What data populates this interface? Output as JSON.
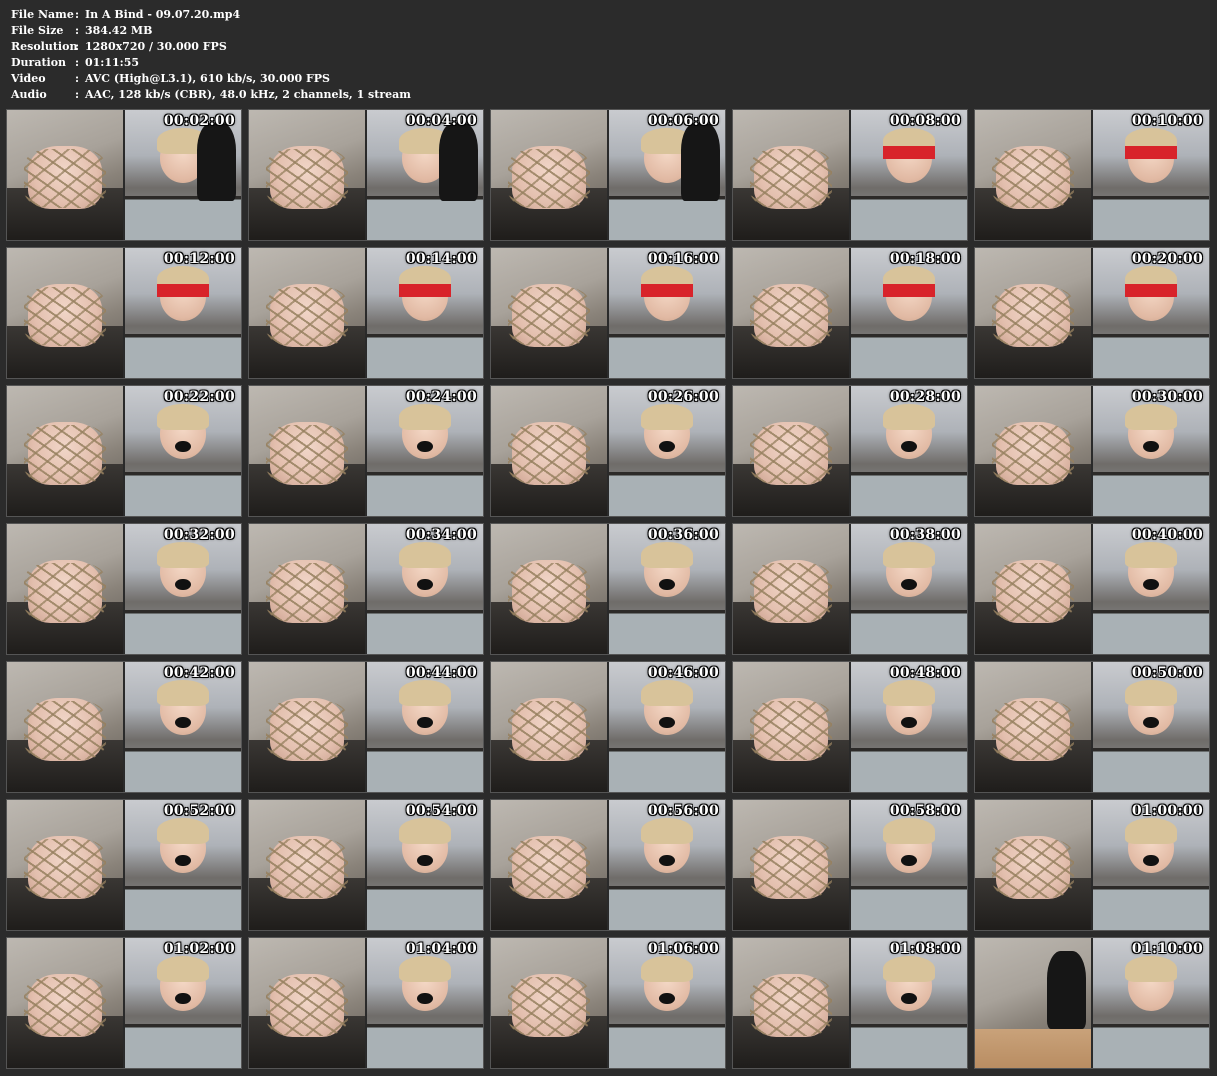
{
  "info": [
    {
      "label": "File Name",
      "sep": ":",
      "value": "In A Bind - 09.07.20.mp4"
    },
    {
      "label": "File Size",
      "sep": ":",
      "value": "384.42 MB"
    },
    {
      "label": "Resolution",
      "sep": ":",
      "value": "1280x720 / 30.000 FPS"
    },
    {
      "label": "Duration",
      "sep": ":",
      "value": "01:11:55"
    },
    {
      "label": "Video",
      "sep": ":",
      "value": "AVC (High@L3.1), 610 kb/s, 30.000 FPS"
    },
    {
      "label": "Audio",
      "sep": ":",
      "value": "AAC, 128 kb/s (CBR), 48.0 kHz, 2 channels, 1 stream"
    }
  ],
  "thumbnails": [
    {
      "time": "00:02:00",
      "variant": "man"
    },
    {
      "time": "00:04:00",
      "variant": "man"
    },
    {
      "time": "00:06:00",
      "variant": "man"
    },
    {
      "time": "00:08:00",
      "variant": "blindfold"
    },
    {
      "time": "00:10:00",
      "variant": "blindfold"
    },
    {
      "time": "00:12:00",
      "variant": "blindfold"
    },
    {
      "time": "00:14:00",
      "variant": "blindfold"
    },
    {
      "time": "00:16:00",
      "variant": "blindfold"
    },
    {
      "time": "00:18:00",
      "variant": "blindfold"
    },
    {
      "time": "00:20:00",
      "variant": "blindfold"
    },
    {
      "time": "00:22:00",
      "variant": "gag"
    },
    {
      "time": "00:24:00",
      "variant": "gag"
    },
    {
      "time": "00:26:00",
      "variant": "gag"
    },
    {
      "time": "00:28:00",
      "variant": "gag"
    },
    {
      "time": "00:30:00",
      "variant": "gag"
    },
    {
      "time": "00:32:00",
      "variant": "gag"
    },
    {
      "time": "00:34:00",
      "variant": "gag"
    },
    {
      "time": "00:36:00",
      "variant": "gag"
    },
    {
      "time": "00:38:00",
      "variant": "gag"
    },
    {
      "time": "00:40:00",
      "variant": "gag"
    },
    {
      "time": "00:42:00",
      "variant": "gag"
    },
    {
      "time": "00:44:00",
      "variant": "gag"
    },
    {
      "time": "00:46:00",
      "variant": "gag"
    },
    {
      "time": "00:48:00",
      "variant": "gag"
    },
    {
      "time": "00:50:00",
      "variant": "gag"
    },
    {
      "time": "00:52:00",
      "variant": "gag"
    },
    {
      "time": "00:54:00",
      "variant": "gag"
    },
    {
      "time": "00:56:00",
      "variant": "gag"
    },
    {
      "time": "00:58:00",
      "variant": "gag"
    },
    {
      "time": "01:00:00",
      "variant": "gag"
    },
    {
      "time": "01:02:00",
      "variant": "gag"
    },
    {
      "time": "01:04:00",
      "variant": "gag"
    },
    {
      "time": "01:06:00",
      "variant": "gag"
    },
    {
      "time": "01:08:00",
      "variant": "gag"
    },
    {
      "time": "01:10:00",
      "variant": "floor"
    }
  ]
}
